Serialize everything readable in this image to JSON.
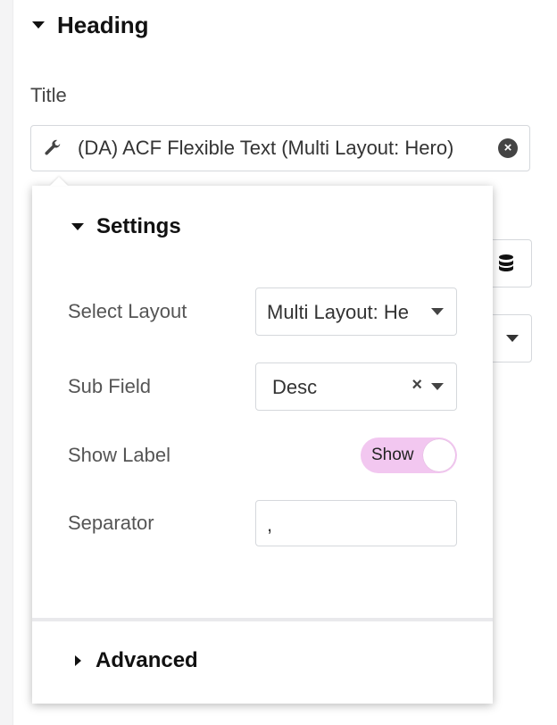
{
  "heading": {
    "label": "Heading"
  },
  "title_field": {
    "label": "Title",
    "value": "(DA) ACF Flexible Text (Multi Layout: Hero)"
  },
  "settings": {
    "label": "Settings",
    "select_layout": {
      "label": "Select Layout",
      "value": "Multi Layout: He"
    },
    "sub_field": {
      "label": "Sub Field",
      "value": "Desc"
    },
    "show_label": {
      "label": "Show Label",
      "toggle_text": "Show",
      "on": true
    },
    "separator": {
      "label": "Separator",
      "value": ","
    }
  },
  "advanced": {
    "label": "Advanced"
  },
  "colors": {
    "toggle_on": "#f2c7f0",
    "border": "#d5d8dc",
    "text_dark": "#111111"
  },
  "icons": [
    "caret-down-icon",
    "wrench-icon",
    "clear-icon",
    "database-icon",
    "caret-right-icon"
  ]
}
